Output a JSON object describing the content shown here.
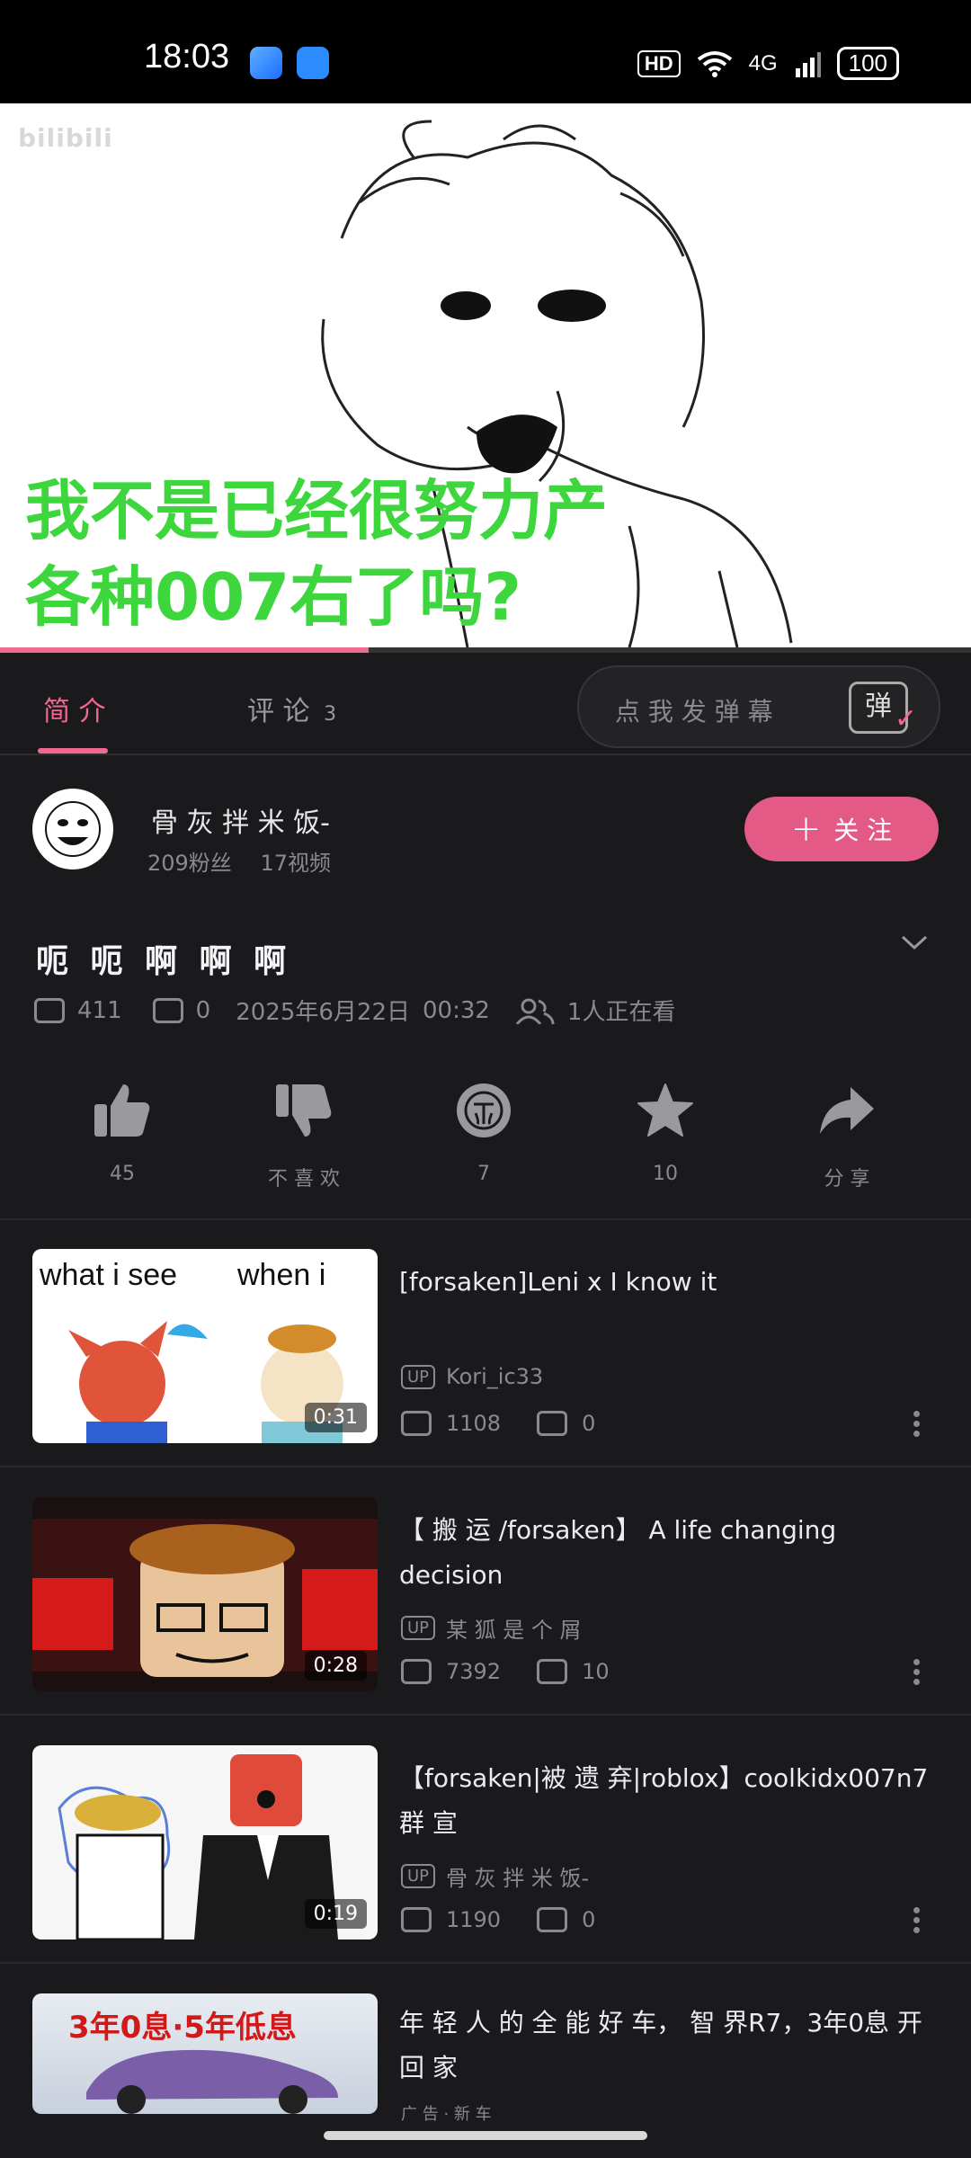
{
  "status_bar": {
    "time": "18:03",
    "hd_label": "HD",
    "network": "4G",
    "battery": "100"
  },
  "player": {
    "watermark": "bilibili",
    "subtitle": "我不是已经很努力产各种007右了吗?",
    "progress_fraction": 0.38
  },
  "tabs": {
    "intro": "简 介",
    "comments": "评 论",
    "comment_count": "3",
    "danmaku_placeholder": "点 我 发 弹 幕",
    "danmaku_toggle": "弹"
  },
  "uploader": {
    "name": "骨 灰 拌 米 饭-",
    "followers": "209粉丝",
    "videos": "17视频",
    "follow_label": "关 注"
  },
  "video": {
    "title": "呃 呃 啊 啊 啊",
    "views": "411",
    "danmaku_count": "0",
    "date": "2025年6月22日",
    "time": "00:32",
    "watching": "1人正在看"
  },
  "actions": [
    {
      "icon": "thumbs-up-icon",
      "label": "45"
    },
    {
      "icon": "thumbs-down-icon",
      "label": "不 喜 欢"
    },
    {
      "icon": "coin-icon",
      "label": "7"
    },
    {
      "icon": "star-icon",
      "label": "10"
    },
    {
      "icon": "share-icon",
      "label": "分 享"
    }
  ],
  "recommendations": [
    {
      "title": "[forsaken]Leni x I know it",
      "author": "Kori_ic33",
      "views": "1108",
      "danmaku": "0",
      "duration": "0:31",
      "thumb_text_1": "what i see",
      "thumb_text_2": "when i"
    },
    {
      "title": "【 搬 运 /forsaken】 A life changing decision",
      "author": "某 狐 是 个 屑",
      "views": "7392",
      "danmaku": "10",
      "duration": "0:28"
    },
    {
      "title": "【forsaken|被 遗 弃|roblox】coolkidx007n7 群 宣",
      "author": "骨 灰 拌 米 饭-",
      "views": "1190",
      "danmaku": "0",
      "duration": "0:19"
    },
    {
      "title": "年 轻 人 的 全 能 好 车， 智 界R7，3年0息 开 回 家",
      "thumb_text": "3年0息·5年低息",
      "footer": "广 告 · 新 车"
    }
  ],
  "colors": {
    "accent_pink": "#e35a86",
    "subtitle_green": "#3dd63d",
    "background": "#1a1a1c"
  }
}
